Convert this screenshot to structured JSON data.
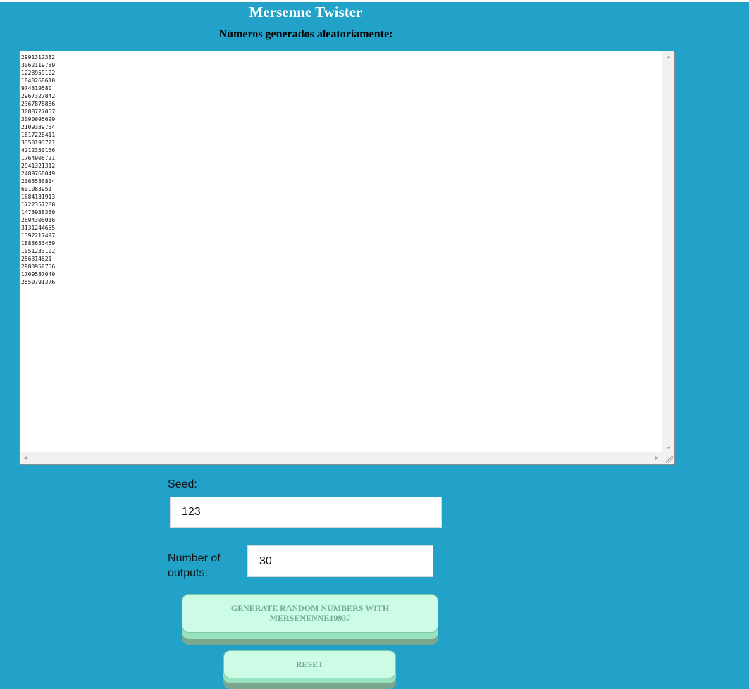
{
  "page": {
    "title": "Mersenne Twister",
    "subtitle": "Números generados aleatoriamente:"
  },
  "output": {
    "lines": [
      "2991312382",
      "3062119789",
      "1228959102",
      "1840268610",
      "974319580",
      "2967327842",
      "2367878886",
      "3088727057",
      "3090095699",
      "2109339754",
      "1817228411",
      "3350193721",
      "4212350166",
      "1764906721",
      "2941321312",
      "2489768049",
      "2065586814",
      "601083951",
      "1684131913",
      "1722357280",
      "1473938350",
      "2694306016",
      "3131244655",
      "1392217497",
      "1883653459",
      "1051233102",
      "256314621",
      "2983950756",
      "1709587040",
      "2550791376"
    ]
  },
  "form": {
    "seed_label": "Seed:",
    "seed_value": "123",
    "outputs_label_line1": "Number of",
    "outputs_label_line2": "outputs:",
    "outputs_value": "30"
  },
  "buttons": {
    "generate_line1": "GENERATE RANDOM NUMBERS WITH",
    "generate_line2": "MERSENENNE19937",
    "reset": "RESET"
  },
  "colors": {
    "background": "#22a2c8",
    "button_face": "#ccfbe6",
    "button_text": "#72ad91",
    "button_shadow": "#99e2c0"
  }
}
